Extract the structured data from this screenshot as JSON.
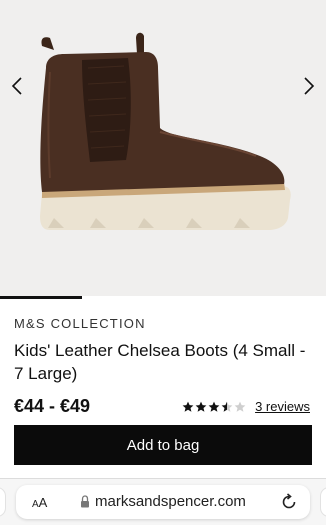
{
  "gallery": {
    "prev_icon": "chevron-left-icon",
    "next_icon": "chevron-right-icon",
    "image_alt": "Brown leather Chelsea boot with elastic side panel and cream sole",
    "progress_fraction": 0.25,
    "colors": {
      "background": "#f0efee",
      "leather": "#4a2f22",
      "leather_dark": "#2e1c14",
      "sole": "#ebe3d2",
      "welt": "#c9a77a"
    }
  },
  "product": {
    "brand": "M&S COLLECTION",
    "title": "Kids' Leather Chelsea Boots (4 Small - 7 Large)",
    "price": "€44 - €49",
    "rating": 3.5,
    "rating_max": 5,
    "reviews_label": "3 reviews",
    "star_icon": "star-icon"
  },
  "actions": {
    "add_to_bag": "Add to bag",
    "button_color": "#0b0b0b"
  },
  "browser": {
    "text_size_label_small": "A",
    "text_size_label_large": "A",
    "url": "marksandspencer.com",
    "lock_icon": "lock-icon",
    "reload_icon": "reload-icon"
  }
}
